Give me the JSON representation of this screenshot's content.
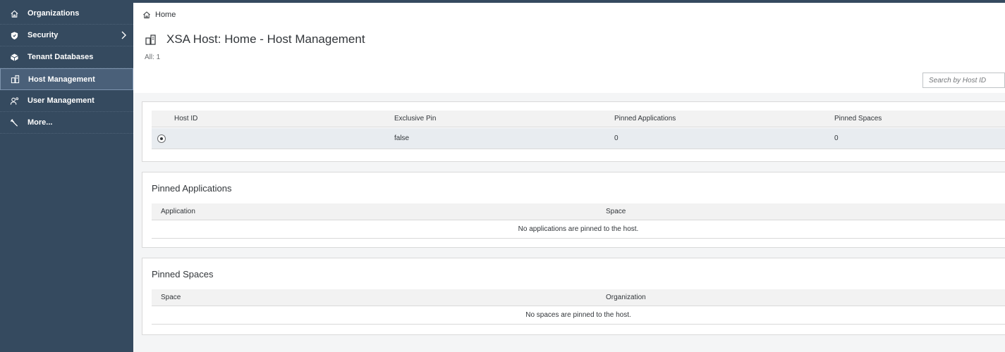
{
  "sidebar": {
    "items": [
      {
        "label": "Organizations",
        "icon": "home-icon",
        "active": false
      },
      {
        "label": "Security",
        "icon": "shield-icon",
        "active": false,
        "has_submenu": true
      },
      {
        "label": "Tenant Databases",
        "icon": "database-icon",
        "active": false
      },
      {
        "label": "Host Management",
        "icon": "host-icon",
        "active": true
      },
      {
        "label": "User Management",
        "icon": "user-settings-icon",
        "active": false
      },
      {
        "label": "More...",
        "icon": "wrench-icon",
        "active": false
      }
    ]
  },
  "breadcrumb": {
    "home_label": "Home"
  },
  "header": {
    "title": "XSA Host: Home - Host Management",
    "count_label": "All: 1"
  },
  "search": {
    "placeholder": "Search by Host ID"
  },
  "hosts_table": {
    "columns": [
      "Host ID",
      "Exclusive Pin",
      "Pinned Applications",
      "Pinned Spaces"
    ],
    "rows": [
      {
        "host_id": "",
        "exclusive_pin": "false",
        "pinned_applications": "0",
        "pinned_spaces": "0",
        "selected": true
      }
    ]
  },
  "pinned_applications": {
    "title": "Pinned Applications",
    "columns": [
      "Application",
      "Space"
    ],
    "empty_text": "No applications are pinned to the host."
  },
  "pinned_spaces": {
    "title": "Pinned Spaces",
    "columns": [
      "Space",
      "Organization"
    ],
    "empty_text": "No spaces are pinned to the host."
  },
  "colors": {
    "sidebar_bg": "#354a5f",
    "sidebar_active": "#4a6079",
    "page_bg": "#f4f5f6",
    "selected_row": "#e8ecf0"
  }
}
